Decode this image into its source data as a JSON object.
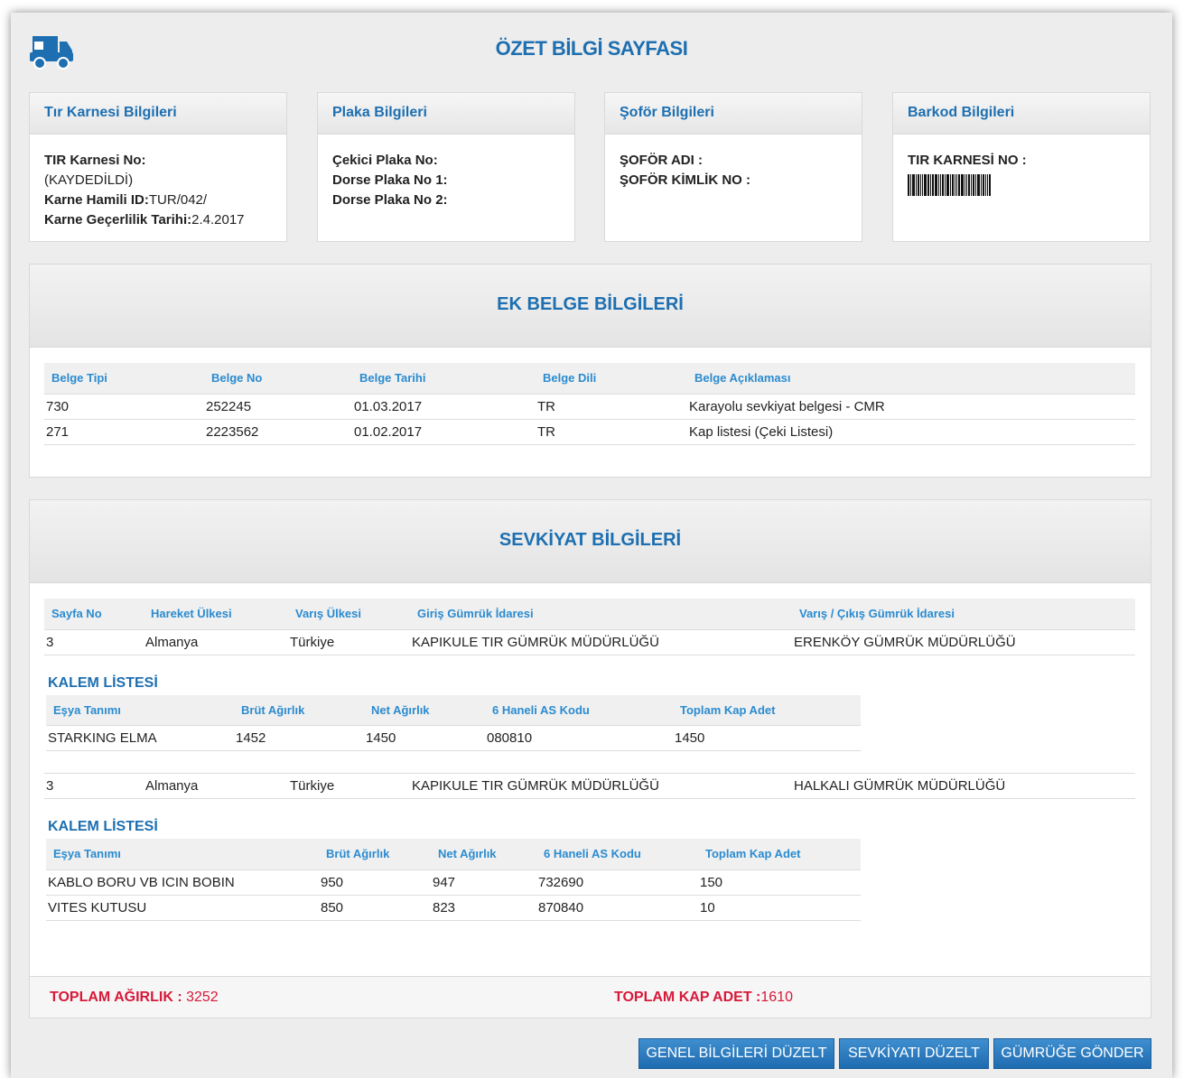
{
  "page_title": "ÖZET BİLGİ SAYFASI",
  "cards": {
    "tir": {
      "title": "Tır Karnesi Bilgileri",
      "no_label": "TIR Karnesi No:",
      "no_value": "(KAYDEDİLDİ)",
      "holder_label": "Karne Hamili ID:",
      "holder_value": "TUR/042/",
      "validity_label": "Karne Geçerlilik Tarihi:",
      "validity_value": "2.4.2017"
    },
    "plaka": {
      "title": "Plaka Bilgileri",
      "cekici_label": "Çekici Plaka No:",
      "dorse1_label": "Dorse Plaka No 1:",
      "dorse2_label": "Dorse Plaka No 2:"
    },
    "sofor": {
      "title": "Şoför Bilgileri",
      "name_label": "ŞOFÖR ADI :",
      "id_label": "ŞOFÖR KİMLİK NO :"
    },
    "barkod": {
      "title": "Barkod Bilgileri",
      "label": "TIR KARNESİ NO :"
    }
  },
  "ek_belge": {
    "title": "EK BELGE BİLGİLERİ",
    "headers": [
      "Belge Tipi",
      "Belge No",
      "Belge Tarihi",
      "Belge Dili",
      "Belge Açıklaması"
    ],
    "rows": [
      [
        "730",
        "252245",
        "01.03.2017",
        "TR",
        "Karayolu sevkiyat belgesi - CMR"
      ],
      [
        "271",
        "2223562",
        "01.02.2017",
        "TR",
        "Kap listesi (Çeki Listesi)"
      ]
    ]
  },
  "sevkiyat": {
    "title": "SEVKİYAT BİLGİLERİ",
    "headers": [
      "Sayfa No",
      "Hareket Ülkesi",
      "Varış Ülkesi",
      "Giriş Gümrük İdaresi",
      "Varış / Çıkış Gümrük İdaresi"
    ],
    "kalem_title": "KALEM LİSTESİ",
    "kalem_headers": [
      "Eşya Tanımı",
      "Brüt Ağırlık",
      "Net Ağırlık",
      "6 Haneli AS Kodu",
      "Toplam Kap Adet"
    ],
    "shipments": [
      {
        "row": [
          "3",
          "Almanya",
          "Türkiye",
          "KAPIKULE TIR GÜMRÜK MÜDÜRLÜĞÜ",
          "ERENKÖY GÜMRÜK MÜDÜRLÜĞÜ"
        ],
        "items": [
          [
            "STARKING ELMA",
            "1452",
            "1450",
            "080810",
            "1450"
          ]
        ]
      },
      {
        "row": [
          "3",
          "Almanya",
          "Türkiye",
          "KAPIKULE TIR GÜMRÜK MÜDÜRLÜĞÜ",
          "HALKALI GÜMRÜK MÜDÜRLÜĞÜ"
        ],
        "items": [
          [
            "KABLO BORU VB ICIN BOBIN",
            "950",
            "947",
            "732690",
            "150"
          ],
          [
            "VITES KUTUSU",
            "850",
            "823",
            "870840",
            "10"
          ]
        ]
      }
    ],
    "total_weight_label": "TOPLAM AĞIRLIK :",
    "total_weight_value": "3252",
    "total_pack_label": "TOPLAM KAP ADET :",
    "total_pack_value": "1610"
  },
  "buttons": {
    "edit_general": "GENEL BİLGİLERİ DÜZELT",
    "edit_shipment": "SEVKİYATI DÜZELT",
    "send_customs": "GÜMRÜĞE GÖNDER"
  },
  "colors": {
    "accent": "#1d6fb1",
    "header_text": "#2a8bd0",
    "total_text": "#d7193a",
    "button": "#2a7cc0"
  }
}
